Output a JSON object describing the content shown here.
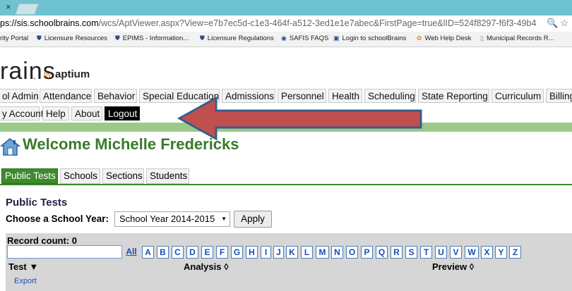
{
  "browser": {
    "close_glyph": "×",
    "url_host": "ps://sis.schoolbrains.com",
    "url_rest": "/wcs/AptViewer.aspx?View=e7b7ec5d-c1e3-464f-a512-3ed1e1e7abec&FirstPage=true&lID=524f8297-f6f3-49b4",
    "bookmarks": [
      "rity Portal",
      "Licensure Resources",
      "EPIMS - Information...",
      "Licensure Regulations",
      "SAFIS FAQS",
      "Login to schoolBrains",
      "Web Help Desk",
      "Municipal Records R..."
    ]
  },
  "brand": {
    "logo_text": "rains",
    "tm": "™",
    "by": "by",
    "aptium": "aptium"
  },
  "menu": {
    "row1": [
      "ol Admin",
      "Attendance",
      "Behavior",
      "Special Education",
      "Admissions",
      "Personnel",
      "Health",
      "Scheduling",
      "State Reporting",
      "Curriculum",
      "Billing"
    ],
    "row2": [
      "y Account",
      "Help",
      "About",
      "Logout"
    ]
  },
  "welcome": "Welcome Michelle Fredericks",
  "subtabs": [
    "Public Tests",
    "Schools",
    "Sections",
    "Students"
  ],
  "section_title": "Public Tests",
  "year": {
    "label": "Choose a School Year:",
    "selected": "School Year 2014-2015",
    "apply": "Apply"
  },
  "list": {
    "record_count": "Record count: 0",
    "search_value": "",
    "letters": [
      "All",
      "A",
      "B",
      "C",
      "D",
      "E",
      "F",
      "G",
      "H",
      "I",
      "J",
      "K",
      "L",
      "M",
      "N",
      "O",
      "P",
      "Q",
      "R",
      "S",
      "T",
      "U",
      "V",
      "W",
      "X",
      "Y",
      "Z"
    ],
    "columns": [
      "Test ▼",
      "Analysis ◊",
      "Preview ◊"
    ],
    "export": "Export"
  },
  "colors": {
    "accent_green": "#3d8a2d",
    "green_bar": "#9cc98a",
    "arrow_fill": "#c0504d",
    "arrow_stroke": "#385d8a",
    "browser_tab": "#6fc2cf"
  }
}
